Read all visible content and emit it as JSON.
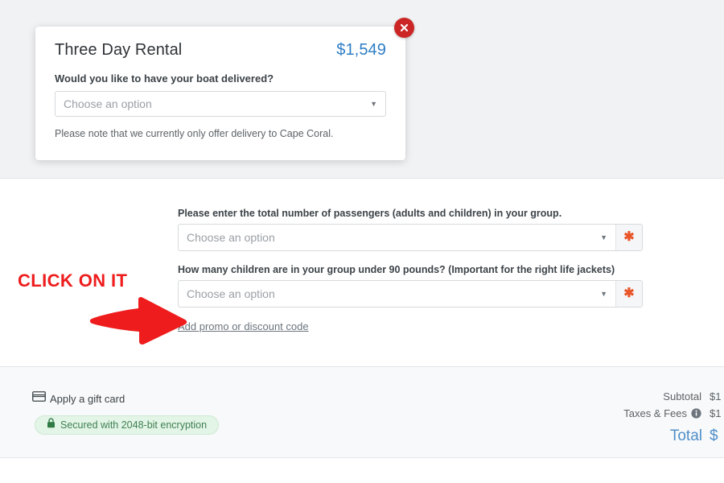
{
  "modal": {
    "title": "Three Day Rental",
    "price": "$1,549",
    "close_icon": "close-icon",
    "question": "Would you like to have your boat delivered?",
    "select_placeholder": "Choose an option",
    "caret_icon": "chevron-down-icon",
    "note": "Please note that we currently only offer delivery to Cape Coral."
  },
  "form": {
    "fields": [
      {
        "label": "Please enter the total number of passengers (adults and children) in your group.",
        "placeholder": "Choose an option",
        "required_marker": "✱"
      },
      {
        "label": "How many children are in your group under 90 pounds? (Important for the right life jackets)",
        "placeholder": "Choose an option",
        "required_marker": "✱"
      }
    ],
    "promo_link": "Add promo or discount code"
  },
  "annotation": {
    "text": "CLICK ON IT",
    "arrow_icon": "arrow-right-icon",
    "color": "#ee1c1c"
  },
  "summary": {
    "gift_card_label": "Apply a gift card",
    "gift_card_icon": "credit-card-icon",
    "secured_label": "Secured with 2048-bit encryption",
    "lock_icon": "lock-icon",
    "info_icon": "info-icon",
    "rows": [
      {
        "label": "Subtotal",
        "value": "$1"
      },
      {
        "label": "Taxes & Fees",
        "value": "$1"
      },
      {
        "label": "Total",
        "value": "$"
      }
    ]
  },
  "colors": {
    "price_blue": "#2d7dc4",
    "required_orange": "#e8562a",
    "annotation_red": "#ee1c1c",
    "close_red": "#cc2525",
    "secured_green": "#3e7f52",
    "total_blue": "#4f8fc9"
  }
}
